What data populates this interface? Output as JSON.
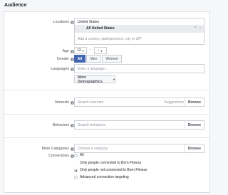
{
  "section_title": "Audience",
  "locations": {
    "label": "Locations",
    "country_header": "United States",
    "selected": "All United States",
    "input_placeholder": "Add a country, state/province, city or ZIP"
  },
  "age": {
    "label": "Age",
    "min": "13",
    "dash": "-",
    "max": "--"
  },
  "gender": {
    "label": "Gender",
    "options": [
      "All",
      "Men",
      "Women"
    ]
  },
  "languages": {
    "label": "Languages",
    "placeholder": "Enter a language..."
  },
  "more_demographics": "More Demographics",
  "interests": {
    "label": "Interests",
    "placeholder": "Search interests",
    "suggestions": "Suggestions",
    "browse": "Browse"
  },
  "behaviors": {
    "label": "Behaviors",
    "placeholder": "Search behaviors",
    "browse": "Browse"
  },
  "more_categories": {
    "label": "More Categories",
    "placeholder": "Choose a category",
    "browse": "Browse"
  },
  "connections": {
    "label": "Connections",
    "options": [
      "All",
      "Only people connected to Born Fitness",
      "Only people not connected to Born Fitness",
      "Advanced connection targeting"
    ],
    "selected_index": 2
  },
  "icons": [
    "info-icon",
    "close-icon",
    "chevron-down-icon",
    "caret-down-icon"
  ]
}
